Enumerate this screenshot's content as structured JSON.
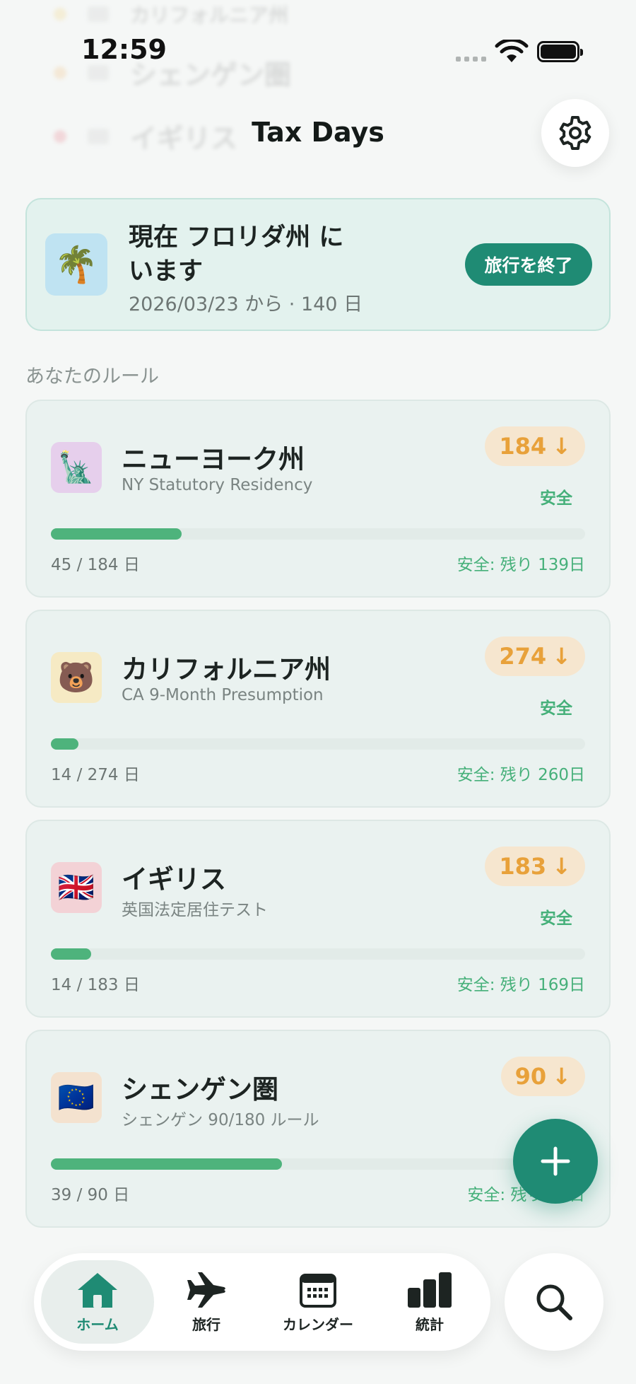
{
  "status_bar": {
    "time": "12:59"
  },
  "background_rows": [
    {
      "name": "カリフォルニア州",
      "dot_color": "#f0c34a"
    },
    {
      "name": "シェンゲン圏",
      "dot_color": "#f0a64a"
    },
    {
      "name": "イギリス",
      "dot_color": "#e2485a"
    }
  ],
  "header": {
    "title": "Tax Days",
    "settings_icon": "gear-icon"
  },
  "current_location": {
    "icon": "🌴",
    "title": "現在 フロリダ州 にいます",
    "subtitle": "2026/03/23 から · 140 日",
    "end_button": "旅行を終了"
  },
  "rules_section": {
    "title": "あなたのルール"
  },
  "rules": [
    {
      "icon": "🗽",
      "icon_bg": "#e6cfec",
      "name": "ニューヨーク州",
      "desc": "NY Statutory Residency",
      "limit": "184",
      "status": "安全",
      "progress": 0.245,
      "count": "45 / 184 日",
      "remaining": "安全: 残り 139日"
    },
    {
      "icon": "🐻",
      "icon_bg": "#f6eac4",
      "name": "カリフォルニア州",
      "desc": "CA 9-Month Presumption",
      "limit": "274",
      "status": "安全",
      "progress": 0.051,
      "count": "14 / 274 日",
      "remaining": "安全: 残り 260日"
    },
    {
      "icon": "🇬🇧",
      "icon_bg": "#f3d2d6",
      "name": "イギリス",
      "desc": "英国法定居住テスト",
      "limit": "183",
      "status": "安全",
      "progress": 0.076,
      "count": "14 / 183 日",
      "remaining": "安全: 残り 169日"
    },
    {
      "icon": "🇪🇺",
      "icon_bg": "#f4e2cf",
      "name": "シェンゲン圏",
      "desc": "シェンゲン 90/180 ルール",
      "limit": "90",
      "status": "安全",
      "progress": 0.433,
      "count": "39 / 90 日",
      "remaining": "安全: 残り 51日"
    }
  ],
  "fab": {
    "icon": "plus-icon"
  },
  "tabbar": {
    "tabs": [
      {
        "label": "ホーム",
        "icon": "home-icon",
        "active": true
      },
      {
        "label": "旅行",
        "icon": "airplane-icon",
        "active": false
      },
      {
        "label": "カレンダー",
        "icon": "calendar-icon",
        "active": false
      },
      {
        "label": "統計",
        "icon": "bar-chart-icon",
        "active": false
      }
    ],
    "search_icon": "search-icon"
  },
  "colors": {
    "accent": "#1f8b74",
    "safe_green": "#4eb37c",
    "limit_orange": "#e8a13a",
    "card_bg": "#eaf2f0"
  }
}
